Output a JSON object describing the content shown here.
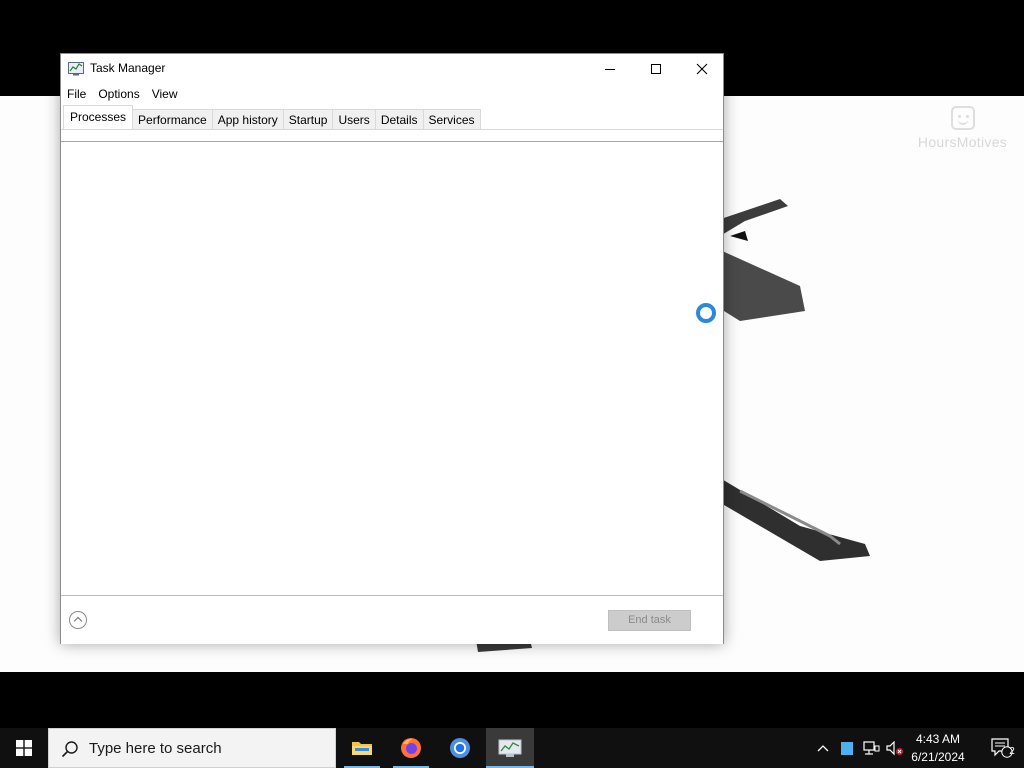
{
  "wallpaper": {
    "watermark": "HoursMotives"
  },
  "window": {
    "title": "Task Manager",
    "menu": [
      "File",
      "Options",
      "View"
    ],
    "tabs": [
      "Processes",
      "Performance",
      "App history",
      "Startup",
      "Users",
      "Details",
      "Services"
    ],
    "active_tab": "Processes",
    "end_task_label": "End task"
  },
  "taskbar": {
    "search_placeholder": "Type here to search",
    "apps": [
      "file-explorer",
      "firefox",
      "chrome",
      "task-manager"
    ],
    "clock_time": "4:43 AM",
    "clock_date": "6/21/2024",
    "notification_count": "2"
  },
  "colors": {
    "accent": "#2b8ad8",
    "taskbar": "#101010",
    "search_bg": "#f3f3f3"
  }
}
